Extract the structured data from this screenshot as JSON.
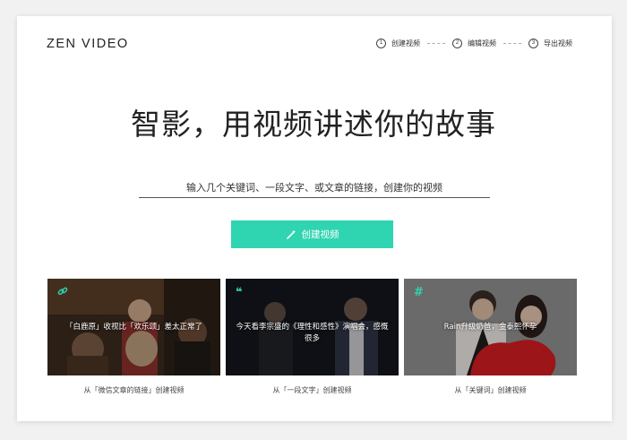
{
  "header": {
    "logo": "ZEN VIDEO",
    "steps": [
      {
        "num": "1",
        "label": "创建视频"
      },
      {
        "num": "2",
        "label": "编辑视频"
      },
      {
        "num": "3",
        "label": "导出视频"
      }
    ]
  },
  "hero": {
    "title": "智影，用视频讲述你的故事",
    "input_placeholder": "输入几个关键词、一段文字、或文章的链接，创建你的视频",
    "create_button": "创建视频"
  },
  "examples": [
    {
      "icon": "link-icon",
      "text": "「白鹿原」收视比「欢乐颂」差太正常了",
      "caption": "从「微信文章的链接」创建视频"
    },
    {
      "icon": "quote-icon",
      "text": "今天看李宗盛的《理性和感性》演唱会，感慨很多",
      "caption": "从「一段文字」创建视频"
    },
    {
      "icon": "hash-icon",
      "text": "Rain升级奶爸，金泰熙怀孕",
      "caption": "从「关键词」创建视频"
    }
  ],
  "colors": {
    "accent": "#2fd4b0",
    "text": "#222222",
    "background": "#f1f1f1"
  }
}
